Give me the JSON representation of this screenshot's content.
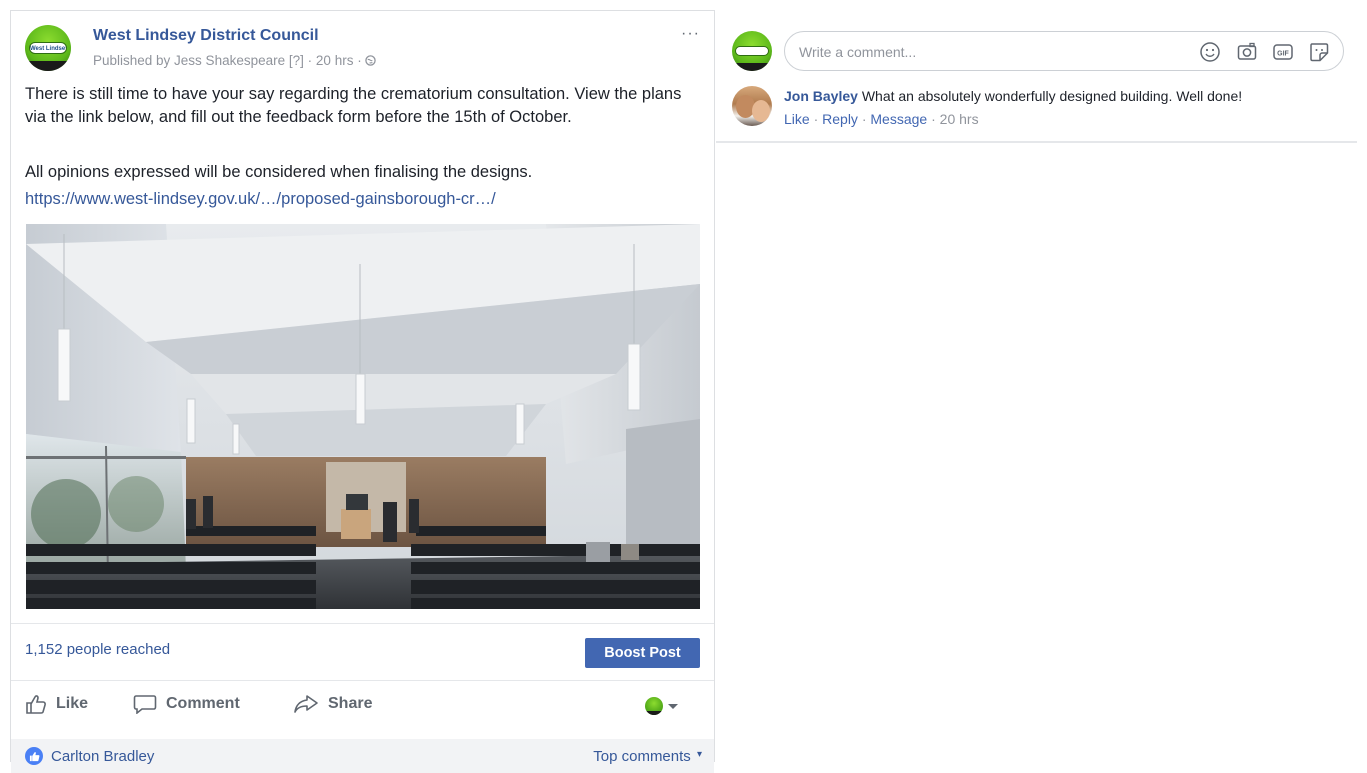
{
  "post": {
    "page_name": "West Lindsey District Council",
    "logo_text": "West Lindsey",
    "published_by": "Published by Jess Shakespeare",
    "help_badge": "[?]",
    "time": "20 hrs",
    "more_label": "···",
    "text_1": "There is still time to have your say regarding the crematorium consultation. View the plans via the link below, and fill out the feedback form before the 15th of October.",
    "text_2": "All opinions expressed will be considered when finalising the designs.",
    "link": "https://www.west-lindsey.gov.uk/…/proposed-gainsborough-cr…/"
  },
  "footer": {
    "reach": "1,152 people reached",
    "boost_label": "Boost Post",
    "like_label": "Like",
    "comment_label": "Comment",
    "share_label": "Share",
    "comment_author": "Carlton Bradley",
    "sort_label": "Top comments"
  },
  "comments": {
    "placeholder": "Write a comment...",
    "reply": {
      "author": "Jon Bayley",
      "text": "What an absolutely wonderfully designed building. Well done!",
      "like": "Like",
      "reply": "Reply",
      "message": "Message",
      "time": "20 hrs"
    }
  },
  "icons": {
    "emoji": "smiley-icon",
    "camera": "camera-icon",
    "gif": "gif-icon",
    "sticker": "sticker-icon",
    "globe": "globe-icon",
    "like": "thumbs-up-icon",
    "comment": "speech-bubble-icon",
    "share": "share-arrow-icon"
  },
  "colors": {
    "link_blue": "#365899",
    "boost_blue": "#4267b2",
    "muted_gray": "#90949c"
  }
}
